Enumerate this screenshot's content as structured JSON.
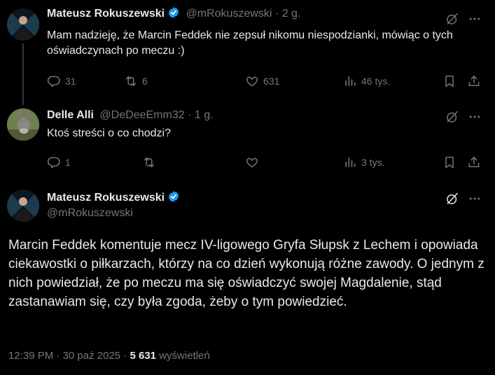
{
  "replies": [
    {
      "name": "Mateusz Rokuszewski",
      "handle": "@mRokuszewski",
      "separator": "·",
      "time": "2 g.",
      "text": "Mam nadzieję, że Marcin Feddek nie zepsuł nikomu niespodzianki, mówiąc o tych oświadczynach po meczu :)",
      "replies_count": "31",
      "reposts_count": "6",
      "likes_count": "631",
      "views_count": "46 tys."
    },
    {
      "name": "Delle Alli",
      "handle": "@DeDeeEmm32",
      "separator": "·",
      "time": "1 g.",
      "text": "Ktoś streści o co chodzi?",
      "replies_count": "1",
      "reposts_count": "",
      "likes_count": "",
      "views_count": "3 tys."
    }
  ],
  "main": {
    "name": "Mateusz Rokuszewski",
    "handle": "@mRokuszewski",
    "text": "Marcin Feddek komentuje mecz IV-ligowego Gryfa Słupsk z Lechem i opowiada ciekawostki o piłkarzach, którzy na co dzień wykonują różne zawody. O jednym z nich powiedział, że po meczu ma się oświadczyć swojej Magdalenie, stąd zastanawiam się, czy była zgoda, żeby o tym powiedzieć.",
    "time": "12:39 PM",
    "separator": "·",
    "date": "30 paź 2025",
    "views_count": "5 631",
    "views_label": "wyświetleń"
  },
  "colors": {
    "background": "#000000",
    "text": "#e7e9ea",
    "muted": "#71767b",
    "verified": "#1d9bf0"
  },
  "icons": [
    "reply-icon",
    "repost-icon",
    "like-icon",
    "views-icon",
    "bookmark-icon",
    "share-icon",
    "grok-icon",
    "more-icon",
    "verified-icon"
  ]
}
